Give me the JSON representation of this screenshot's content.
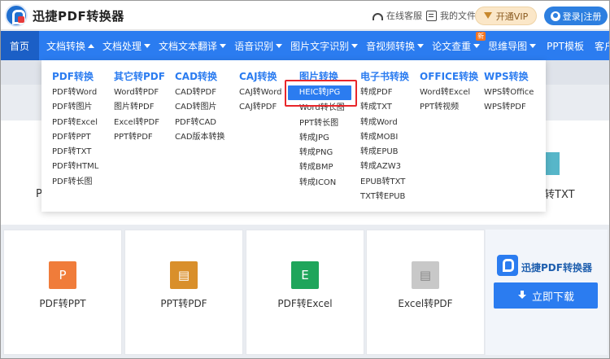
{
  "header": {
    "brand": "迅捷PDF转换器",
    "service": "在线客服",
    "files": "我的文件",
    "vip": "开通VIP",
    "login": "登录|注册"
  },
  "nav": [
    {
      "label": "首页"
    },
    {
      "label": "文档转换",
      "caret": "up"
    },
    {
      "label": "文档处理",
      "caret": "down"
    },
    {
      "label": "文档文本翻译",
      "caret": "down"
    },
    {
      "label": "语音识别",
      "caret": "down"
    },
    {
      "label": "图片文字识别",
      "caret": "down"
    },
    {
      "label": "音视频转换",
      "caret": "down"
    },
    {
      "label": "论文查重",
      "caret": "down",
      "badge": "新"
    },
    {
      "label": "思维导图",
      "caret": "down"
    },
    {
      "label": "PPT模板"
    },
    {
      "label": "客户端",
      "caret": "down"
    }
  ],
  "dropdown": {
    "columns": [
      {
        "title": "PDF转换",
        "items": [
          "PDF转Word",
          "PDF转图片",
          "PDF转Excel",
          "PDF转PPT",
          "PDF转TXT",
          "PDF转HTML",
          "PDF转长图"
        ]
      },
      {
        "title": "其它转PDF",
        "items": [
          "Word转PDF",
          "图片转PDF",
          "Excel转PDF",
          "PPT转PDF"
        ]
      },
      {
        "title": "CAD转换",
        "items": [
          "CAD转PDF",
          "CAD转图片",
          "PDF转CAD",
          "CAD版本转换"
        ]
      },
      {
        "title": "CAJ转换",
        "items": [
          "CAJ转Word",
          "CAJ转PDF"
        ]
      },
      {
        "title": "图片转换",
        "items": [
          "HEIC转JPG",
          "Word转长图",
          "PPT转长图",
          "转成JPG",
          "转成PNG",
          "转成BMP",
          "转成ICON"
        ],
        "highlighted": 0
      },
      {
        "title": "电子书转换",
        "items": [
          "转成PDF",
          "转成TXT",
          "转成Word",
          "转成MOBI",
          "转成EPUB",
          "转成AZW3",
          "EPUB转TXT",
          "TXT转EPUB"
        ]
      },
      {
        "title": "OFFICE转换",
        "items": [
          "Word转Excel",
          "PPT转视频"
        ]
      },
      {
        "title": "WPS转换",
        "items": [
          "WPS转Office",
          "WPS转PDF"
        ]
      }
    ]
  },
  "background": {
    "left_partial": "P",
    "right_partial": "转TXT",
    "tiles": [
      {
        "label": "PDF转PPT",
        "icon_letter": "P",
        "icon_color": "#f07c3a"
      },
      {
        "label": "PPT转PDF",
        "icon_letter": "▤",
        "icon_color": "#d98f2b"
      },
      {
        "label": "PDF转Excel",
        "icon_letter": "E",
        "icon_color": "#1fa55b"
      },
      {
        "label": "Excel转PDF",
        "icon_letter": "▤",
        "icon_color": "#c8c8c8"
      }
    ],
    "promo": {
      "title": "迅捷PDF转换器",
      "button": "立即下载"
    }
  },
  "colors": {
    "primary": "#2b7cf0",
    "nav_active": "#1b5fc6",
    "highlight_border": "#e8262a"
  }
}
